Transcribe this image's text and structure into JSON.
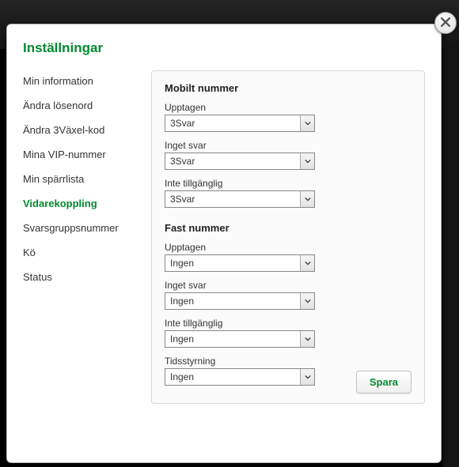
{
  "title": "Inställningar",
  "sidebar": {
    "items": [
      {
        "label": "Min information",
        "active": false
      },
      {
        "label": "Ändra lösenord",
        "active": false
      },
      {
        "label": "Ändra 3Växel-kod",
        "active": false
      },
      {
        "label": "Mina VIP-nummer",
        "active": false
      },
      {
        "label": "Min spärrlista",
        "active": false
      },
      {
        "label": "Vidarekoppling",
        "active": true
      },
      {
        "label": "Svarsgruppsnummer",
        "active": false
      },
      {
        "label": "Kö",
        "active": false
      },
      {
        "label": "Status",
        "active": false
      }
    ]
  },
  "panel": {
    "mobile_heading": "Mobilt nummer",
    "fixed_heading": "Fast nummer",
    "mobile": [
      {
        "label": "Upptagen",
        "value": "3Svar"
      },
      {
        "label": "Inget svar",
        "value": "3Svar"
      },
      {
        "label": "Inte tillgänglig",
        "value": "3Svar"
      }
    ],
    "fixed": [
      {
        "label": "Upptagen",
        "value": "Ingen"
      },
      {
        "label": "Inget svar",
        "value": "Ingen"
      },
      {
        "label": "Inte tillgänglig",
        "value": "Ingen"
      },
      {
        "label": "Tidsstyrning",
        "value": "Ingen"
      }
    ],
    "save_label": "Spara"
  }
}
